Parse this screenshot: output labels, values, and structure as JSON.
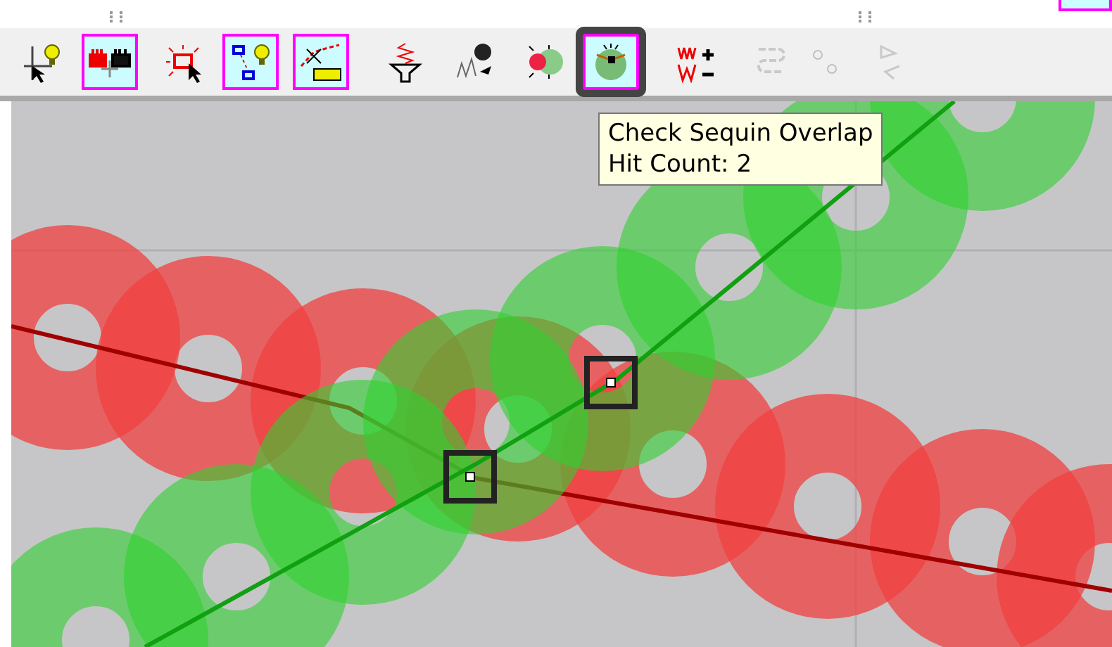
{
  "toolbar": {
    "tools": [
      {
        "on": false,
        "disabled": false,
        "selected": false
      },
      {
        "on": true,
        "disabled": false,
        "selected": false
      },
      {
        "on": false,
        "disabled": false,
        "selected": false
      },
      {
        "on": true,
        "disabled": false,
        "selected": false
      },
      {
        "on": true,
        "disabled": false,
        "selected": false
      },
      {
        "on": false,
        "disabled": false,
        "selected": false
      },
      {
        "on": false,
        "disabled": false,
        "selected": false
      },
      {
        "on": false,
        "disabled": false,
        "selected": false
      },
      {
        "on": true,
        "disabled": false,
        "selected": true
      },
      {
        "on": false,
        "disabled": false,
        "selected": false
      },
      {
        "on": false,
        "disabled": true,
        "selected": false
      },
      {
        "on": false,
        "disabled": true,
        "selected": false
      },
      {
        "on": false,
        "disabled": true,
        "selected": false
      }
    ]
  },
  "tooltip": {
    "title": "Check Sequin Overlap",
    "detail": "Hit Count: 2"
  }
}
